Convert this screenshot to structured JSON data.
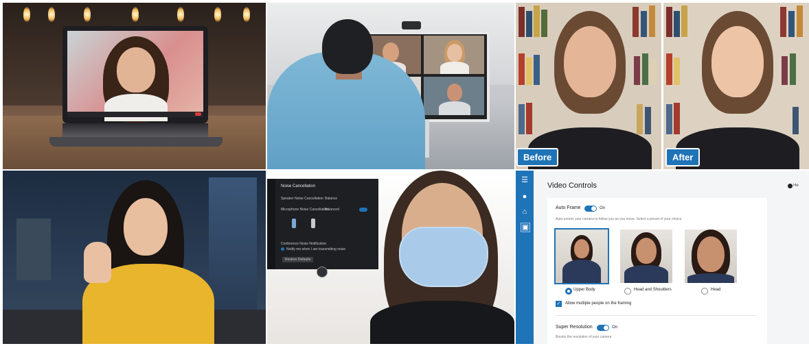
{
  "before_after": {
    "before_label": "Before",
    "after_label": "After"
  },
  "noise_panel": {
    "title": "Noise Cancellation",
    "row1": "Speaker Noise Cancellation",
    "row1_value": "Balance",
    "row2": "Microphone Noise Cancellation",
    "row2_value": "Balanced",
    "row3": "Conference Noise Notification",
    "row3_sub": "Notify me when I am transmitting noise",
    "button": "Restore Defaults"
  },
  "video_controls": {
    "title": "Video Controls",
    "help": "He",
    "auto_frame_label": "Auto Frame",
    "auto_frame_state": "On",
    "auto_frame_desc": "Auto-zooms your camera to follow you as you move. Select a preset of your choice.",
    "options": [
      {
        "label": "Upper Body",
        "selected": true
      },
      {
        "label": "Head and Shoulders",
        "selected": false
      },
      {
        "label": "Head",
        "selected": false
      }
    ],
    "multi_people_label": "Allow multiple people on the framing",
    "super_res_label": "Super Resolution",
    "super_res_state": "On",
    "super_res_desc": "Boosts the resolution of your camera"
  },
  "colors": {
    "accent": "#1f73b7"
  }
}
